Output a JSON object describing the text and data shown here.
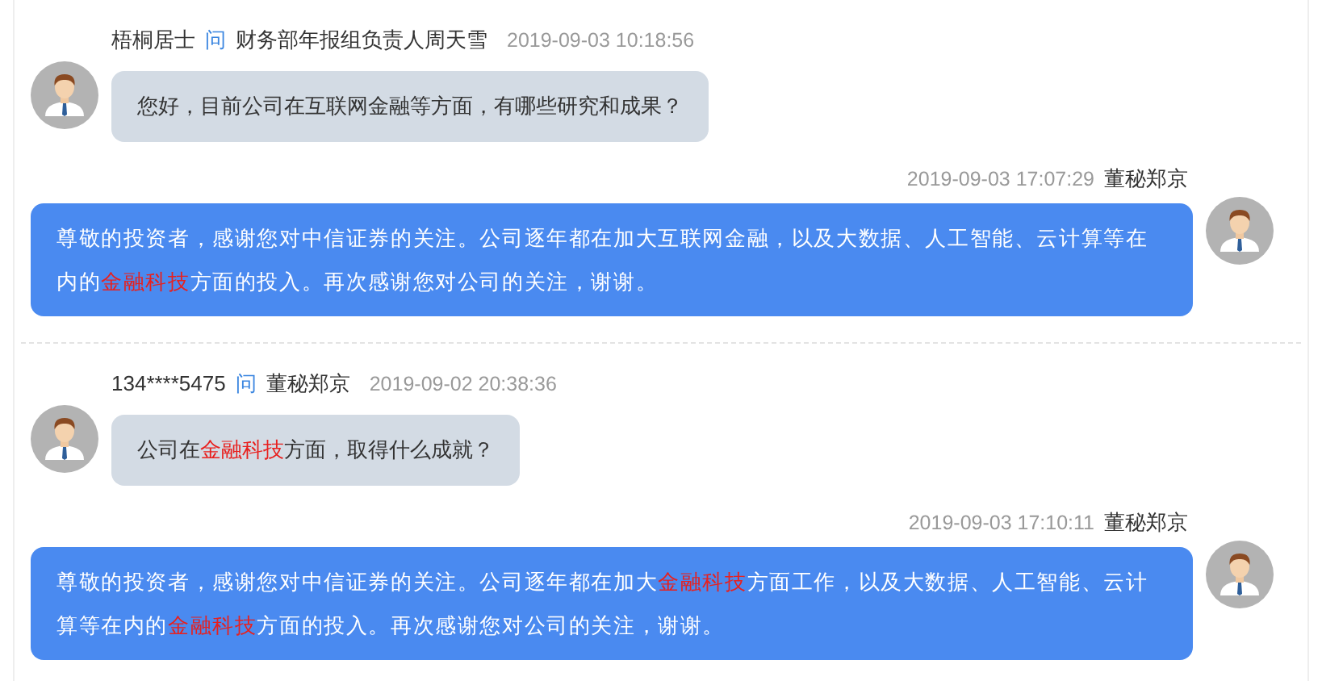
{
  "threads": [
    {
      "question": {
        "asker": "梧桐居士",
        "ask_label": "问",
        "addressee": "财务部年报组负责人周天雪",
        "time": "2019-09-03 10:18:56",
        "segments": [
          {
            "text": "您好，目前公司在互联网金融等方面，有哪些研究和成果？",
            "highlight": false
          }
        ]
      },
      "answer": {
        "time": "2019-09-03 17:07:29",
        "responder": "董秘郑京",
        "segments": [
          {
            "text": "尊敬的投资者，感谢您对中信证券的关注。公司逐年都在加大互联网金融，以及大数据、人工智能、云计算等在内的",
            "highlight": false
          },
          {
            "text": "金融科技",
            "highlight": true
          },
          {
            "text": "方面的投入。再次感谢您对公司的关注，谢谢。",
            "highlight": false
          }
        ]
      }
    },
    {
      "question": {
        "asker": "134****5475",
        "ask_label": "问",
        "addressee": "董秘郑京",
        "time": "2019-09-02 20:38:36",
        "segments": [
          {
            "text": "公司在",
            "highlight": false
          },
          {
            "text": "金融科技",
            "highlight": true
          },
          {
            "text": "方面，取得什么成就？",
            "highlight": false
          }
        ]
      },
      "answer": {
        "time": "2019-09-03 17:10:11",
        "responder": "董秘郑京",
        "segments": [
          {
            "text": "尊敬的投资者，感谢您对中信证券的关注。公司逐年都在加大",
            "highlight": false
          },
          {
            "text": "金融科技",
            "highlight": true
          },
          {
            "text": "方面工作，以及大数据、人工智能、云计算等在内的",
            "highlight": false
          },
          {
            "text": "金融科技",
            "highlight": true
          },
          {
            "text": "方面的投入。再次感谢您对公司的关注，谢谢。",
            "highlight": false
          }
        ]
      }
    }
  ]
}
